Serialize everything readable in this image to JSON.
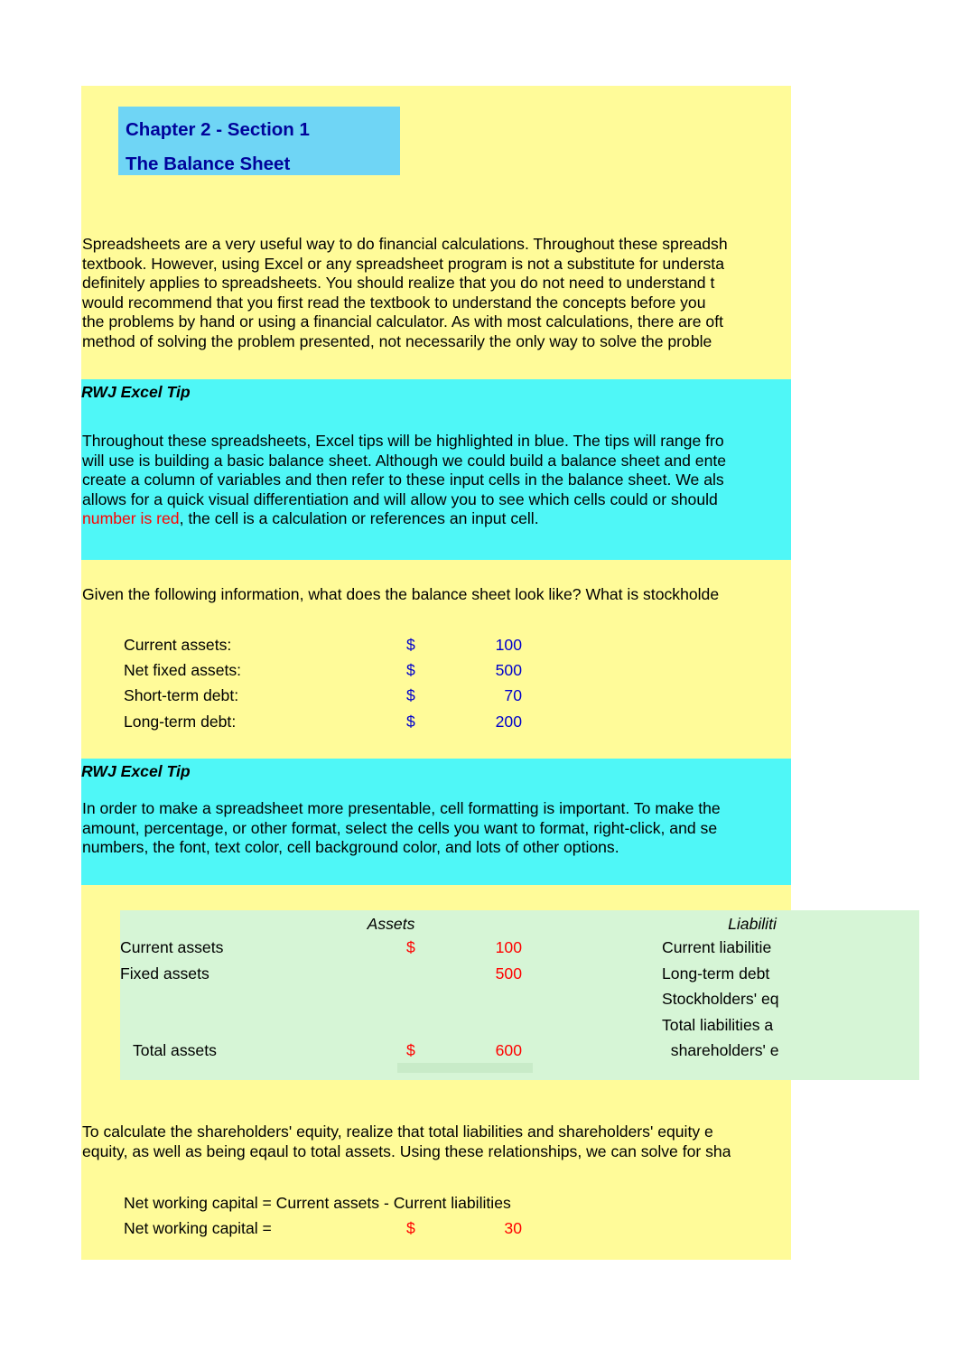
{
  "title": {
    "line1": "Chapter 2 - Section 1",
    "line2": "The Balance Sheet",
    "bg": "#6FD5F5",
    "color": "#00039B"
  },
  "intro": {
    "lines": [
      "Spreadsheets are a very useful way to do financial calculations. Throughout these spreadsh",
      "textbook. However, using Excel or any spreadsheet program is not a substitute for understa",
      "definitely applies to spreadsheets. You should realize that you do not need to understand t",
      "would recommend that you first read the textbook to understand the concepts before you",
      "the problems by hand or using a financial calculator. As with most calculations, there are oft",
      "method of solving the problem presented, not necessarily the only way to solve the proble"
    ]
  },
  "tip1": {
    "heading": "RWJ Excel Tip",
    "lines": [
      "Throughout these spreadsheets, Excel tips will be highlighted in blue. The tips will range fro",
      "will use is building a basic balance sheet. Although we could build a balance sheet and ente",
      "create a column of variables and then refer to these input cells in the balance sheet. We als",
      "allows for a quick visual differentiation and will allow you to see which cells could or should"
    ],
    "last_red": "number is red",
    "last_rest": ", the cell is a calculation or references an input cell.",
    "bg": "#4FF7F7"
  },
  "question": "Given the following information, what does the balance sheet look like? What is stockholde",
  "inputs": {
    "currency": "$",
    "rows": [
      {
        "label": "Current assets:",
        "currency": "$",
        "value": "100"
      },
      {
        "label": "Net fixed assets:",
        "currency": "$",
        "value": "500"
      },
      {
        "label": "Short-term debt:",
        "currency": "$",
        "value": "70"
      },
      {
        "label": "Long-term debt:",
        "currency": "$",
        "value": "200"
      }
    ],
    "value_color": "#0000CC"
  },
  "tip2": {
    "heading": "RWJ Excel Tip",
    "lines": [
      "In order to make a spreadsheet more presentable, cell formatting is important. To make the",
      "amount, percentage, or other format, select the cells you want to format, right-click, and se",
      "numbers, the font, text color, cell background color, and lots of other options."
    ],
    "bg": "#4FF7F7"
  },
  "balance_sheet": {
    "bg": "#D6F5D6",
    "assets_header": "Assets",
    "liabilities_header": "Liabiliti",
    "assets": [
      {
        "label": "Current assets",
        "currency": "$",
        "value": "100"
      },
      {
        "label": "Fixed assets",
        "currency": "",
        "value": "500"
      }
    ],
    "assets_total": {
      "label": "Total assets",
      "currency": "$",
      "value": "600"
    },
    "liabilities": [
      "Current liabilitie",
      "Long-term debt",
      "Stockholders' eq",
      "Total liabilities a",
      "  shareholders' e"
    ],
    "value_color": "#FF0000"
  },
  "conclusion": {
    "lines": [
      "To calculate the shareholders' equity, realize that total liabilities and shareholders' equity e",
      "equity, as well as being eqaul to total assets. Using these relationships, we can solve for sha"
    ]
  },
  "nwc": {
    "formula_label": "Net working capital = Current assets - Current liabilities",
    "result_label": "Net working capital =",
    "currency": "$",
    "value": "30",
    "value_color": "#FF0000"
  }
}
